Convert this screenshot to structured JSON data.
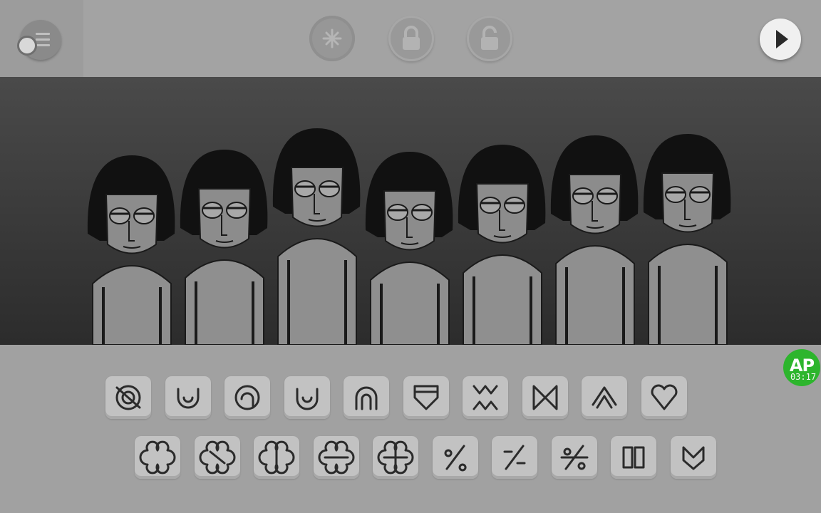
{
  "toolbar": {
    "menu_icon": "hamburger-icon",
    "buttons": [
      {
        "icon": "sparkle-icon",
        "state": "active"
      },
      {
        "icon": "lock-icon",
        "state": "locked"
      },
      {
        "icon": "unlock-icon",
        "state": "locked"
      }
    ],
    "play_icon": "play-icon"
  },
  "stage": {
    "characters": 7,
    "background": "#3a3a3a"
  },
  "sound_icons": {
    "row1": [
      "target-icon",
      "horseshoe-icon",
      "spiral-target-icon",
      "shield-ring-icon",
      "arch-icon",
      "flag-icon",
      "spark-burst-icon",
      "bowtie-icon",
      "diamond-arrow-icon",
      "heart-knot-icon"
    ],
    "row2": [
      "clover-1-icon",
      "clover-2-icon",
      "clover-3-icon",
      "clover-4-icon",
      "clover-5-icon",
      "percent-1-icon",
      "percent-2-icon",
      "percent-3-icon",
      "parallel-bars-icon",
      "heart-shield-icon"
    ]
  },
  "badge": {
    "label": "AP",
    "time": "03:17",
    "color": "#2db52d"
  }
}
